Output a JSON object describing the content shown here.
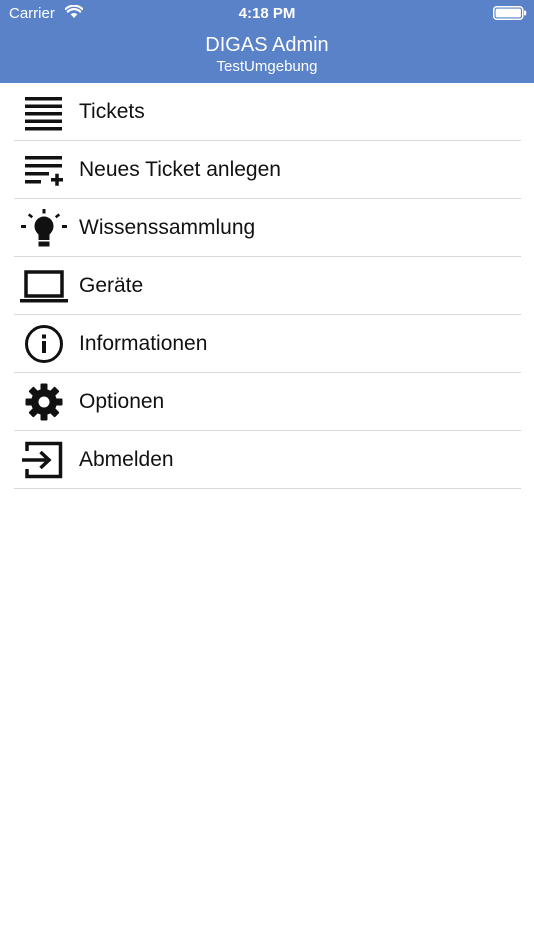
{
  "status_bar": {
    "carrier": "Carrier",
    "time": "4:18 PM"
  },
  "nav": {
    "title": "DIGAS Admin",
    "subtitle": "TestUmgebung"
  },
  "colors": {
    "header_bg": "#5a82c8",
    "header_text": "#ffffff",
    "separator": "#d9d9d9"
  },
  "menu": {
    "items": [
      {
        "label": "Tickets",
        "icon": "list-icon"
      },
      {
        "label": "Neues Ticket anlegen",
        "icon": "playlist-add-icon"
      },
      {
        "label": "Wissenssammlung",
        "icon": "lightbulb-icon"
      },
      {
        "label": "Geräte",
        "icon": "laptop-icon"
      },
      {
        "label": "Informationen",
        "icon": "info-icon"
      },
      {
        "label": "Optionen",
        "icon": "gear-icon"
      },
      {
        "label": "Abmelden",
        "icon": "logout-icon"
      }
    ]
  }
}
